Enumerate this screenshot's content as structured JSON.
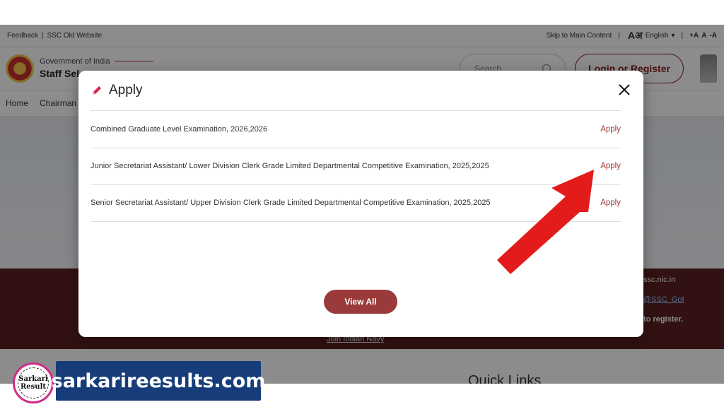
{
  "topbar": {
    "feedback": "Feedback",
    "old_website": "SSC Old Website",
    "skip": "Skip to Main Content",
    "lang_glyph": "Aअ",
    "language": "English",
    "font_sizes": [
      "+A",
      "A",
      "-A"
    ]
  },
  "header": {
    "gov": "Government of India",
    "org_name": "Staff Sel",
    "search_placeholder": "Search",
    "login_label": "Login or Register"
  },
  "nav": {
    "items": [
      "Home",
      "Chairman"
    ]
  },
  "banner": {
    "email": "ssc.nic.in",
    "twitter": "@SSC_GoI",
    "note": "to register.",
    "link": "Join Indian Navy"
  },
  "quick_links": "Quick Links",
  "modal": {
    "title": "Apply",
    "rows": [
      {
        "name": "Combined Graduate Level Examination, 2026,2026",
        "action": "Apply"
      },
      {
        "name": "Junior Secretariat Assistant/ Lower Division Clerk Grade Limited Departmental Competitive Examination, 2025,2025",
        "action": "Apply"
      },
      {
        "name": "Senior Secretariat Assistant/ Upper Division Clerk Grade Limited Departmental Competitive Examination, 2025,2025",
        "action": "Apply"
      }
    ],
    "view_all": "View All"
  },
  "watermark": {
    "logo_line1": "Sarkari",
    "logo_line2": "Result",
    "site": "sarkarireesults.com"
  },
  "colors": {
    "accent": "#9a3a3a",
    "apply_link": "#9e3a3a",
    "banner": "#5a2020",
    "arrow": "#e31b1b",
    "watermark_bg": "#163d7a"
  },
  "icons": [
    "pencil-icon",
    "close-icon",
    "search-icon",
    "arrow-annotation"
  ]
}
